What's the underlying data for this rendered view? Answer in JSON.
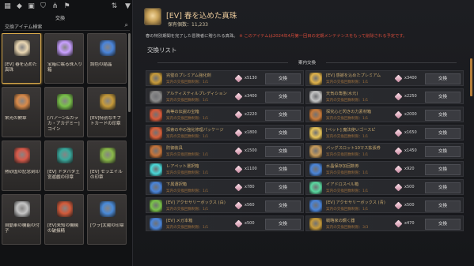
{
  "left_panel": {
    "top_tab": "交換",
    "search_label": "交換アイテム検索",
    "cards": [
      {
        "name": "[EV] 春を込めた真珠",
        "color": "#e9d6b2",
        "selected": true
      },
      {
        "name": "宝箱に眠る珠入り箱",
        "color": "#c8a0ff",
        "selected": false
      },
      {
        "name": "調色の結晶",
        "color": "#4a84d8",
        "selected": false
      },
      {
        "name": "栄光の勲章",
        "color": "#d88a4a",
        "selected": false
      },
      {
        "name": "[パアーン&カラ カ・アカデミー]コイン",
        "color": "#7ac24a",
        "selected": false
      },
      {
        "name": "[EV]特別なギフトカードの印章",
        "color": "#c69a3a",
        "selected": false
      },
      {
        "name": "熱砂国の記念刻印",
        "color": "#d85a4a",
        "selected": false
      },
      {
        "name": "[EV] ドタバタ王宮遊戯の印章",
        "color": "#3aa89c",
        "selected": false
      },
      {
        "name": "[EV] セラエイルの印章",
        "color": "#8ab84a",
        "selected": false
      },
      {
        "name": "自動車の機能の付子",
        "color": "#c4c4c4",
        "selected": false
      },
      {
        "name": "[EV]未知の機械の破損精",
        "color": "#d25a3a",
        "selected": false
      },
      {
        "name": "[ヴラ]太陽の印章",
        "color": "#4a8ad8",
        "selected": false
      }
    ]
  },
  "header": {
    "title": "[EV] 春を込めた真珠",
    "holdings": "保有個数：11,233",
    "desc_main": "春の特別期間を完了した冒険者に贈られる真珠。",
    "desc_warn": "※ このアイテムは2024年4月第一回目の定期メンテナンスをもって削除される予定です。"
  },
  "list": {
    "title": "交換リスト",
    "section": "案内交換",
    "button_label": "交換",
    "rows": [
      {
        "name": "完璧のプレミアム強化剤",
        "limit": "案内の交換回数制限：1/1",
        "cost": "x5130",
        "icon": "#c69a3a"
      },
      {
        "name": "[EV] 感謝を込めたプレミアム",
        "limit": "案内の交換回数制限：1/1",
        "cost": "x3400",
        "icon": "#e0b24a"
      },
      {
        "name": "アルティスティルプレディション",
        "limit": "案内の交換回数制限：1/1",
        "cost": "x3400",
        "icon": "#8a8a8a"
      },
      {
        "name": "天気の角笛(水元)",
        "limit": "案内の交換回数制限：1/1",
        "cost": "x2250",
        "icon": "#c4c4c4"
      },
      {
        "name": "高等の伝説の宝箱",
        "limit": "案内の交換回数制限：1/1",
        "cost": "x2220",
        "icon": "#d85a3a"
      },
      {
        "name": "探究心と閃きの力素材箱",
        "limit": "案内の交換回数制限：1/1",
        "cost": "x2000",
        "icon": "#c87a3a"
      },
      {
        "name": "探索の中の強化修理パッケージ",
        "limit": "案内の交換回数制限：1/1",
        "cost": "x1800",
        "icon": "#d8603a"
      },
      {
        "name": "[ペット] 魔法使いゴースピ",
        "limit": "案内の交換回数制限：1/1",
        "cost": "x1650",
        "icon": "#e8c45a"
      },
      {
        "name": "防御装具",
        "limit": "案内の交換回数制限：1/1",
        "cost": "x1500",
        "icon": "#c4733a"
      },
      {
        "name": "バッグスロット10マス拡張券",
        "limit": "案内の交換回数制限：1/1",
        "cost": "x1450",
        "icon": "#c69a5a"
      },
      {
        "name": "レアペット選択箱",
        "limit": "案内の交換回数制限：1/1",
        "cost": "x1100",
        "icon": "#4ad8d8"
      },
      {
        "name": "水晶保存加回数券",
        "limit": "案内の交換回数制限：1/1",
        "cost": "x920",
        "icon": "#4a84d8"
      },
      {
        "name": "下属選択箱",
        "limit": "案内の交換回数制限：1/1",
        "cost": "x780",
        "icon": "#4a84d8"
      },
      {
        "name": "イアドロスペル箱",
        "limit": "案内の交換回数制限：1/1",
        "cost": "x500",
        "icon": "#5ad8a0"
      },
      {
        "name": "[EV] アクセサリーボックス (白)",
        "limit": "案内の交換回数制限：1/1",
        "cost": "x560",
        "icon": "#7ac24a"
      },
      {
        "name": "[EV] アクセサリーボックス (青)",
        "limit": "案内の交換回数制限：1/1",
        "cost": "x500",
        "icon": "#4a84d8"
      },
      {
        "name": "[EV] メガ本箱",
        "limit": "案内の交換回数制限：1/1",
        "cost": "x500",
        "icon": "#4a84d8"
      },
      {
        "name": "戦略家の鋼く器",
        "limit": "案内の交換回数制限：3/3",
        "cost": "x470",
        "icon": "#c69a3a"
      }
    ]
  }
}
